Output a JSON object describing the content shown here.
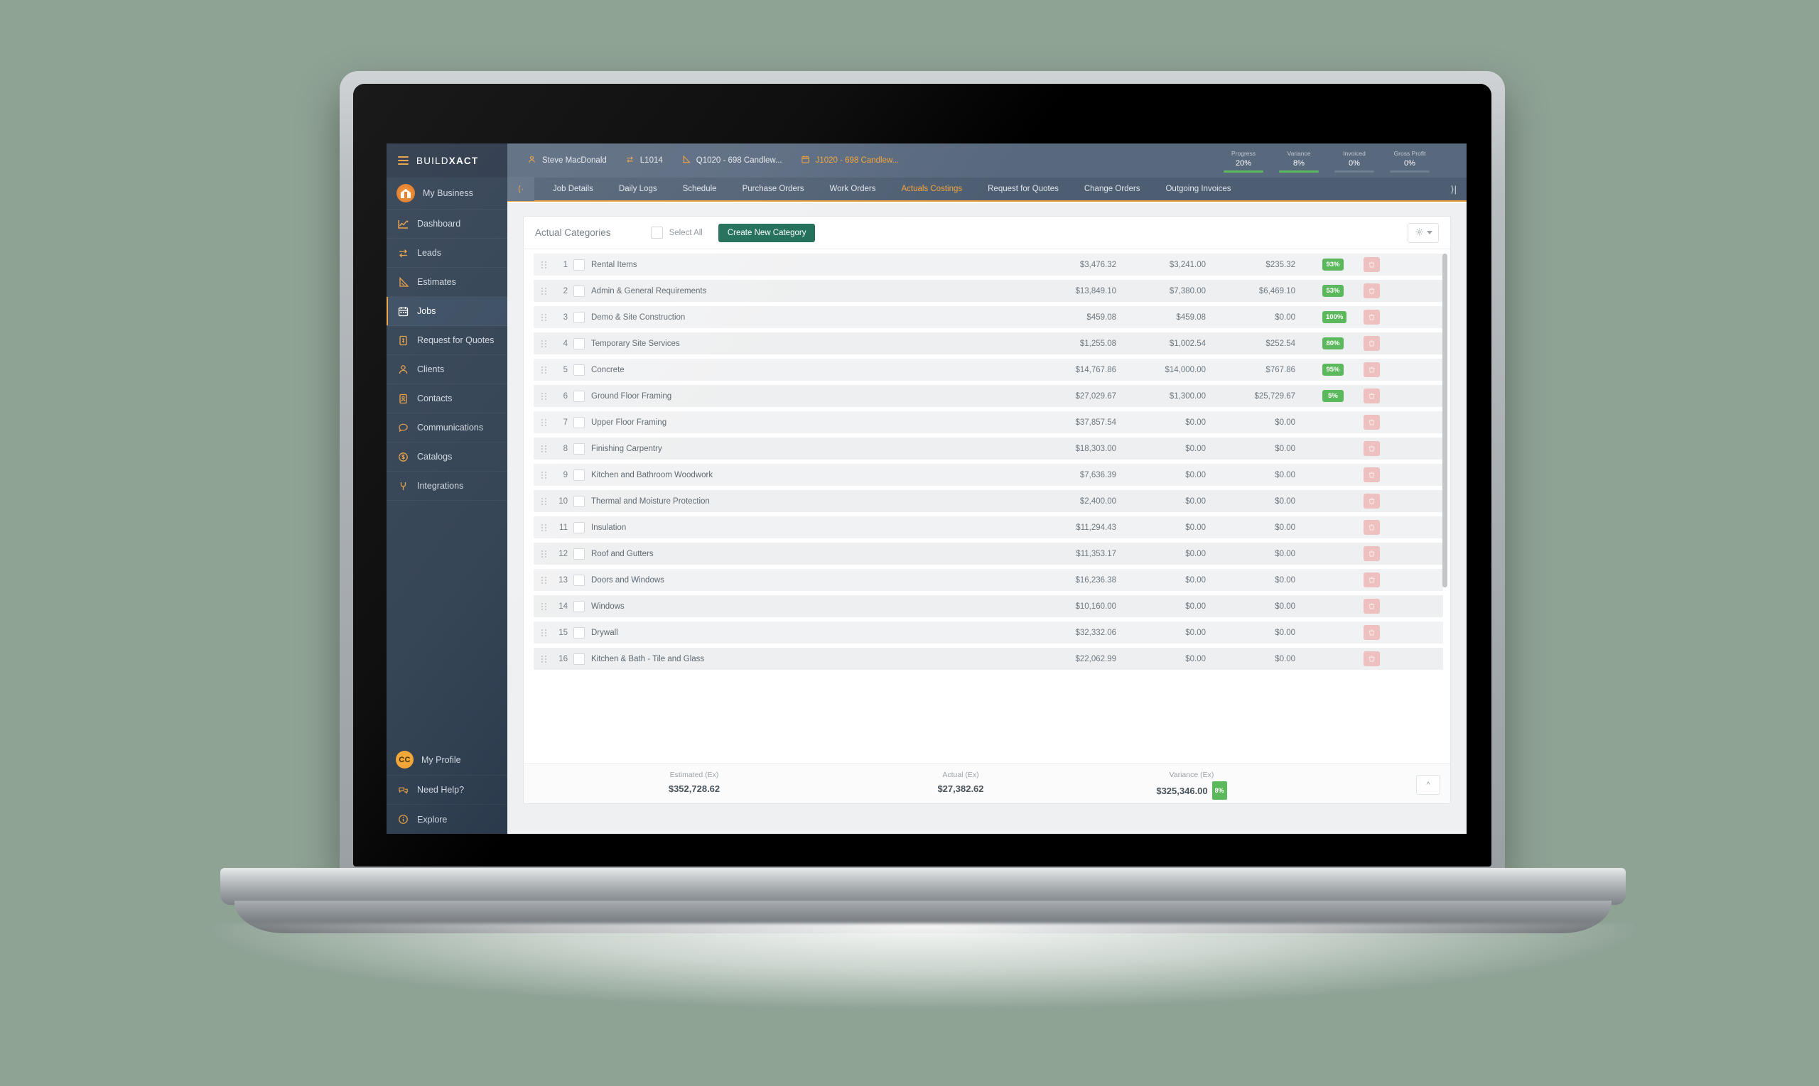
{
  "brand": {
    "logo_prefix": "BUILD",
    "logo_suffix": "XACT",
    "accent": "#e79c3c",
    "green": "#1b6b55",
    "badge_green": "#5cb85c",
    "delete_pink": "#eec0c0"
  },
  "sidebar": {
    "business_label": "My Business",
    "items": [
      {
        "label": "Dashboard",
        "icon": "chart-line-icon",
        "active": false
      },
      {
        "label": "Leads",
        "icon": "swap-arrows-icon",
        "active": false
      },
      {
        "label": "Estimates",
        "icon": "set-square-icon",
        "active": false
      },
      {
        "label": "Jobs",
        "icon": "calendar-icon",
        "active": true
      },
      {
        "label": "Request for Quotes",
        "icon": "quote-document-icon",
        "active": false
      },
      {
        "label": "Clients",
        "icon": "person-icon",
        "active": false
      },
      {
        "label": "Contacts",
        "icon": "contact-card-icon",
        "active": false
      },
      {
        "label": "Communications",
        "icon": "speech-bubble-icon",
        "active": false
      },
      {
        "label": "Catalogs",
        "icon": "dollar-circle-icon",
        "active": false
      },
      {
        "label": "Integrations",
        "icon": "plug-icon",
        "active": false
      }
    ],
    "profile": {
      "initials": "CC",
      "label": "My Profile"
    },
    "help_label": "Need Help?",
    "explore_label": "Explore"
  },
  "topbar": {
    "crumbs": [
      {
        "label": "Steve MacDonald",
        "icon": "person-icon",
        "highlight": false
      },
      {
        "label": "L1014",
        "icon": "swap-arrows-icon",
        "highlight": false
      },
      {
        "label": "Q1020 - 698 Candlew...",
        "icon": "set-square-icon",
        "highlight": false
      },
      {
        "label": "J1020 - 698 Candlew...",
        "icon": "calendar-icon",
        "highlight": true
      }
    ],
    "metrics": [
      {
        "label": "Progress",
        "value": "20%",
        "filled": true
      },
      {
        "label": "Variance",
        "value": "8%",
        "filled": true
      },
      {
        "label": "Invoiced",
        "value": "0%",
        "filled": false
      },
      {
        "label": "Gross Profit",
        "value": "0%",
        "filled": false
      }
    ]
  },
  "tabs": {
    "back_icon": "chevron-left-icon",
    "forward_icon": "chevron-right-icon",
    "items": [
      {
        "label": "Job Details",
        "selected": false
      },
      {
        "label": "Daily Logs",
        "selected": false
      },
      {
        "label": "Schedule",
        "selected": false
      },
      {
        "label": "Purchase Orders",
        "selected": false
      },
      {
        "label": "Work Orders",
        "selected": false
      },
      {
        "label": "Actuals Costings",
        "selected": true
      },
      {
        "label": "Request for Quotes",
        "selected": false
      },
      {
        "label": "Change Orders",
        "selected": false
      },
      {
        "label": "Outgoing Invoices",
        "selected": false
      }
    ]
  },
  "panel": {
    "title": "Actual Categories",
    "select_all_label": "Select All",
    "create_button": "Create New Category",
    "settings_icon": "gear-icon",
    "scroll_top_icon": "chevron-up-icon"
  },
  "table": {
    "rows": [
      {
        "num": "1",
        "name": "Rental Items",
        "estimated": "$3,476.32",
        "actual": "$3,241.00",
        "variance": "$235.32",
        "percent": "93%"
      },
      {
        "num": "2",
        "name": "Admin & General Requirements",
        "estimated": "$13,849.10",
        "actual": "$7,380.00",
        "variance": "$6,469.10",
        "percent": "53%"
      },
      {
        "num": "3",
        "name": "Demo & Site Construction",
        "estimated": "$459.08",
        "actual": "$459.08",
        "variance": "$0.00",
        "percent": "100%"
      },
      {
        "num": "4",
        "name": "Temporary Site Services",
        "estimated": "$1,255.08",
        "actual": "$1,002.54",
        "variance": "$252.54",
        "percent": "80%"
      },
      {
        "num": "5",
        "name": "Concrete",
        "estimated": "$14,767.86",
        "actual": "$14,000.00",
        "variance": "$767.86",
        "percent": "95%"
      },
      {
        "num": "6",
        "name": "Ground Floor Framing",
        "estimated": "$27,029.67",
        "actual": "$1,300.00",
        "variance": "$25,729.67",
        "percent": "5%"
      },
      {
        "num": "7",
        "name": "Upper Floor Framing",
        "estimated": "$37,857.54",
        "actual": "$0.00",
        "variance": "$0.00",
        "percent": ""
      },
      {
        "num": "8",
        "name": "Finishing Carpentry",
        "estimated": "$18,303.00",
        "actual": "$0.00",
        "variance": "$0.00",
        "percent": ""
      },
      {
        "num": "9",
        "name": "Kitchen and Bathroom Woodwork",
        "estimated": "$7,636.39",
        "actual": "$0.00",
        "variance": "$0.00",
        "percent": ""
      },
      {
        "num": "10",
        "name": "Thermal and Moisture Protection",
        "estimated": "$2,400.00",
        "actual": "$0.00",
        "variance": "$0.00",
        "percent": ""
      },
      {
        "num": "11",
        "name": "Insulation",
        "estimated": "$11,294.43",
        "actual": "$0.00",
        "variance": "$0.00",
        "percent": ""
      },
      {
        "num": "12",
        "name": "Roof and Gutters",
        "estimated": "$11,353.17",
        "actual": "$0.00",
        "variance": "$0.00",
        "percent": ""
      },
      {
        "num": "13",
        "name": "Doors and Windows",
        "estimated": "$16,236.38",
        "actual": "$0.00",
        "variance": "$0.00",
        "percent": ""
      },
      {
        "num": "14",
        "name": "Windows",
        "estimated": "$10,160.00",
        "actual": "$0.00",
        "variance": "$0.00",
        "percent": ""
      },
      {
        "num": "15",
        "name": "Drywall",
        "estimated": "$32,332.06",
        "actual": "$0.00",
        "variance": "$0.00",
        "percent": ""
      },
      {
        "num": "16",
        "name": "Kitchen & Bath - Tile and Glass",
        "estimated": "$22,062.99",
        "actual": "$0.00",
        "variance": "$0.00",
        "percent": ""
      }
    ]
  },
  "totals": {
    "estimated_label": "Estimated (Ex)",
    "estimated_value": "$352,728.62",
    "actual_label": "Actual (Ex)",
    "actual_value": "$27,382.62",
    "variance_label": "Variance (Ex)",
    "variance_value": "$325,346.00",
    "variance_badge": "8%"
  }
}
